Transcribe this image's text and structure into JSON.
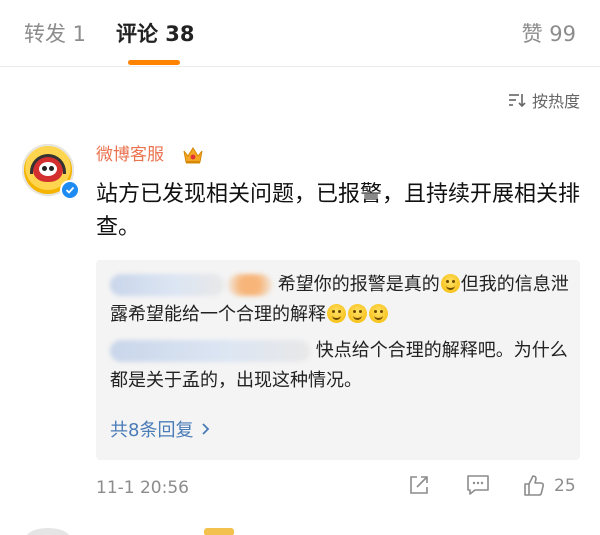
{
  "tabs": {
    "repost": "转发 1",
    "comment": "评论 38",
    "like": "赞 99"
  },
  "sort": {
    "label": "按热度"
  },
  "comment": {
    "username": "微博客服",
    "text": "站方已发现相关问题，已报警，且持续开展相关排查。",
    "timestamp": "11-1 20:56",
    "like_count": "25"
  },
  "replies": {
    "items": [
      {
        "text_a": "希望你的报警是真的",
        "text_b": "但我的信息泄露希望能给一个合理的解释"
      },
      {
        "text": "快点给个合理的解释吧。为什么都是关于孟的，出现这种情况。"
      }
    ],
    "more_label": "共8条回复"
  },
  "colors": {
    "accent": "#ff8200",
    "username": "#eb7350",
    "link": "#4a7cb8",
    "verified": "#1d8bf2"
  },
  "icons": [
    "sort-icon",
    "verified-icon",
    "crown-icon",
    "chevron-right-icon",
    "share-icon",
    "reply-icon",
    "like-icon"
  ]
}
